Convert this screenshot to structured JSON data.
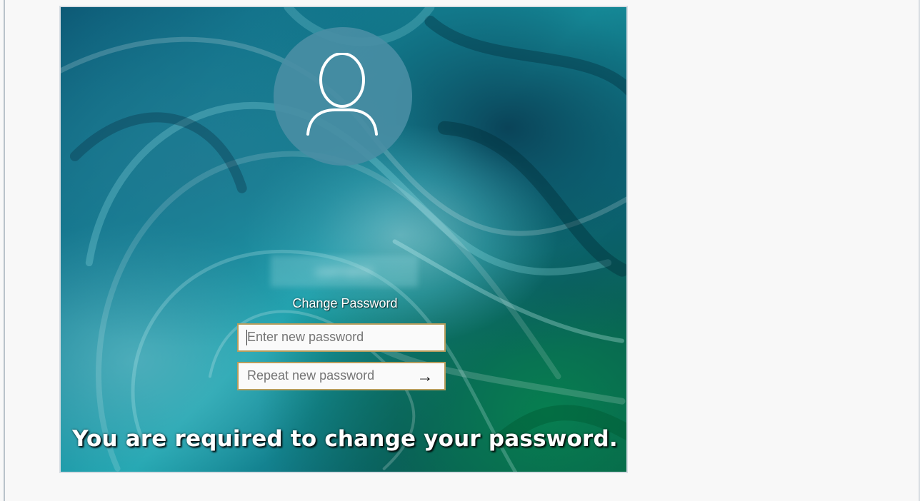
{
  "login_screen": {
    "user_icon": "user-silhouette-icon",
    "username_display": "username",
    "title": "Change Password",
    "new_password": {
      "placeholder": "Enter new password",
      "value": ""
    },
    "repeat_password": {
      "placeholder": "Repeat new password",
      "value": "",
      "submit_icon": "arrow-right-icon",
      "submit_glyph": "→"
    },
    "notice": "You are required to change your password."
  },
  "colors": {
    "page_background": "#f8f8f8",
    "accent_border": "#b79d5d",
    "background_teal": "#1ca5b0",
    "background_green": "#06684d",
    "avatar_fill": "#498ea4"
  }
}
